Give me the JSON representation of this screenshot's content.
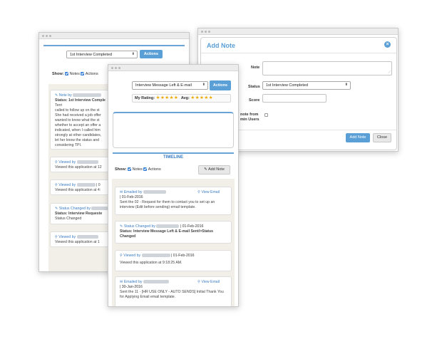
{
  "back_window": {
    "status_select": "1st Interview Completed",
    "actions_label": "Actions",
    "show_label": "Show:",
    "notes_label": "Notes",
    "actions_filter_label": "Actions",
    "note_card": {
      "title": "Note by",
      "status": "Status: 1st Interview Comple",
      "word": "Terri",
      "lines": [
        "called to follow up on the st",
        "She had received a job offer",
        "wanted to know what the st",
        "whether to accept an offer a",
        "indicated, when I called him",
        "strongly at other candidates,",
        "let her know the status and",
        "considering TPI."
      ]
    },
    "viewed_card_1": {
      "title": "Viewed by",
      "text": "Viewed this application at 12"
    },
    "viewed_card_2": {
      "title": "Viewed by",
      "sep": "| 0",
      "text": "Viewed this application at 4:"
    },
    "status_card": {
      "title": "Status Changed by",
      "status": "Status: Interview Requeste",
      "changed": "Status Changed"
    },
    "viewed_card_3": {
      "title": "Viewed by",
      "text": "Viewed this application at 1"
    }
  },
  "mid_window": {
    "status_select": "Interview Message Left & E-mail",
    "actions_label": "Actions",
    "my_rating_label": "My Rating:",
    "avg_label": "Avg:",
    "stars": "★★★★★",
    "timeline_label": "TIMELINE",
    "show_label": "Show:",
    "notes_label": "Notes",
    "actions_filter_label": "Actions",
    "add_note_label": "Add Note",
    "cards": {
      "c1": {
        "title": "Emailed by",
        "date": "| 01-Feb-2016",
        "view_email": "View Email",
        "text": "Sent the 02 - Request for them to contact you to set up an interview (Edit before sending) email template."
      },
      "c2": {
        "title": "Status Changed by",
        "date": "| 01-Feb-2016",
        "text": "Status: Interview Message Left & E-mail Sent/>Status Changed"
      },
      "c3": {
        "title": "Viewed by",
        "date": "| 01-Feb-2016",
        "text": "Viewed this application at 9:18:25 AM."
      },
      "c4": {
        "title": "Emailed by",
        "date": "| 30-Jan-2016",
        "view_email": "View Email",
        "text": "Sent the 11 - [HR USE ONLY - AUTO SENDS] Initial Thank You for Applying Email email template."
      }
    }
  },
  "add_note_dialog": {
    "title": "Add Note",
    "note_label": "Note",
    "status_label": "Status",
    "status_value": "1st Interview Completed",
    "score_label": "Score",
    "hide_label_1": "note from",
    "hide_label_2": "min Users",
    "add_button": "Add Note",
    "close_button": "Close"
  }
}
